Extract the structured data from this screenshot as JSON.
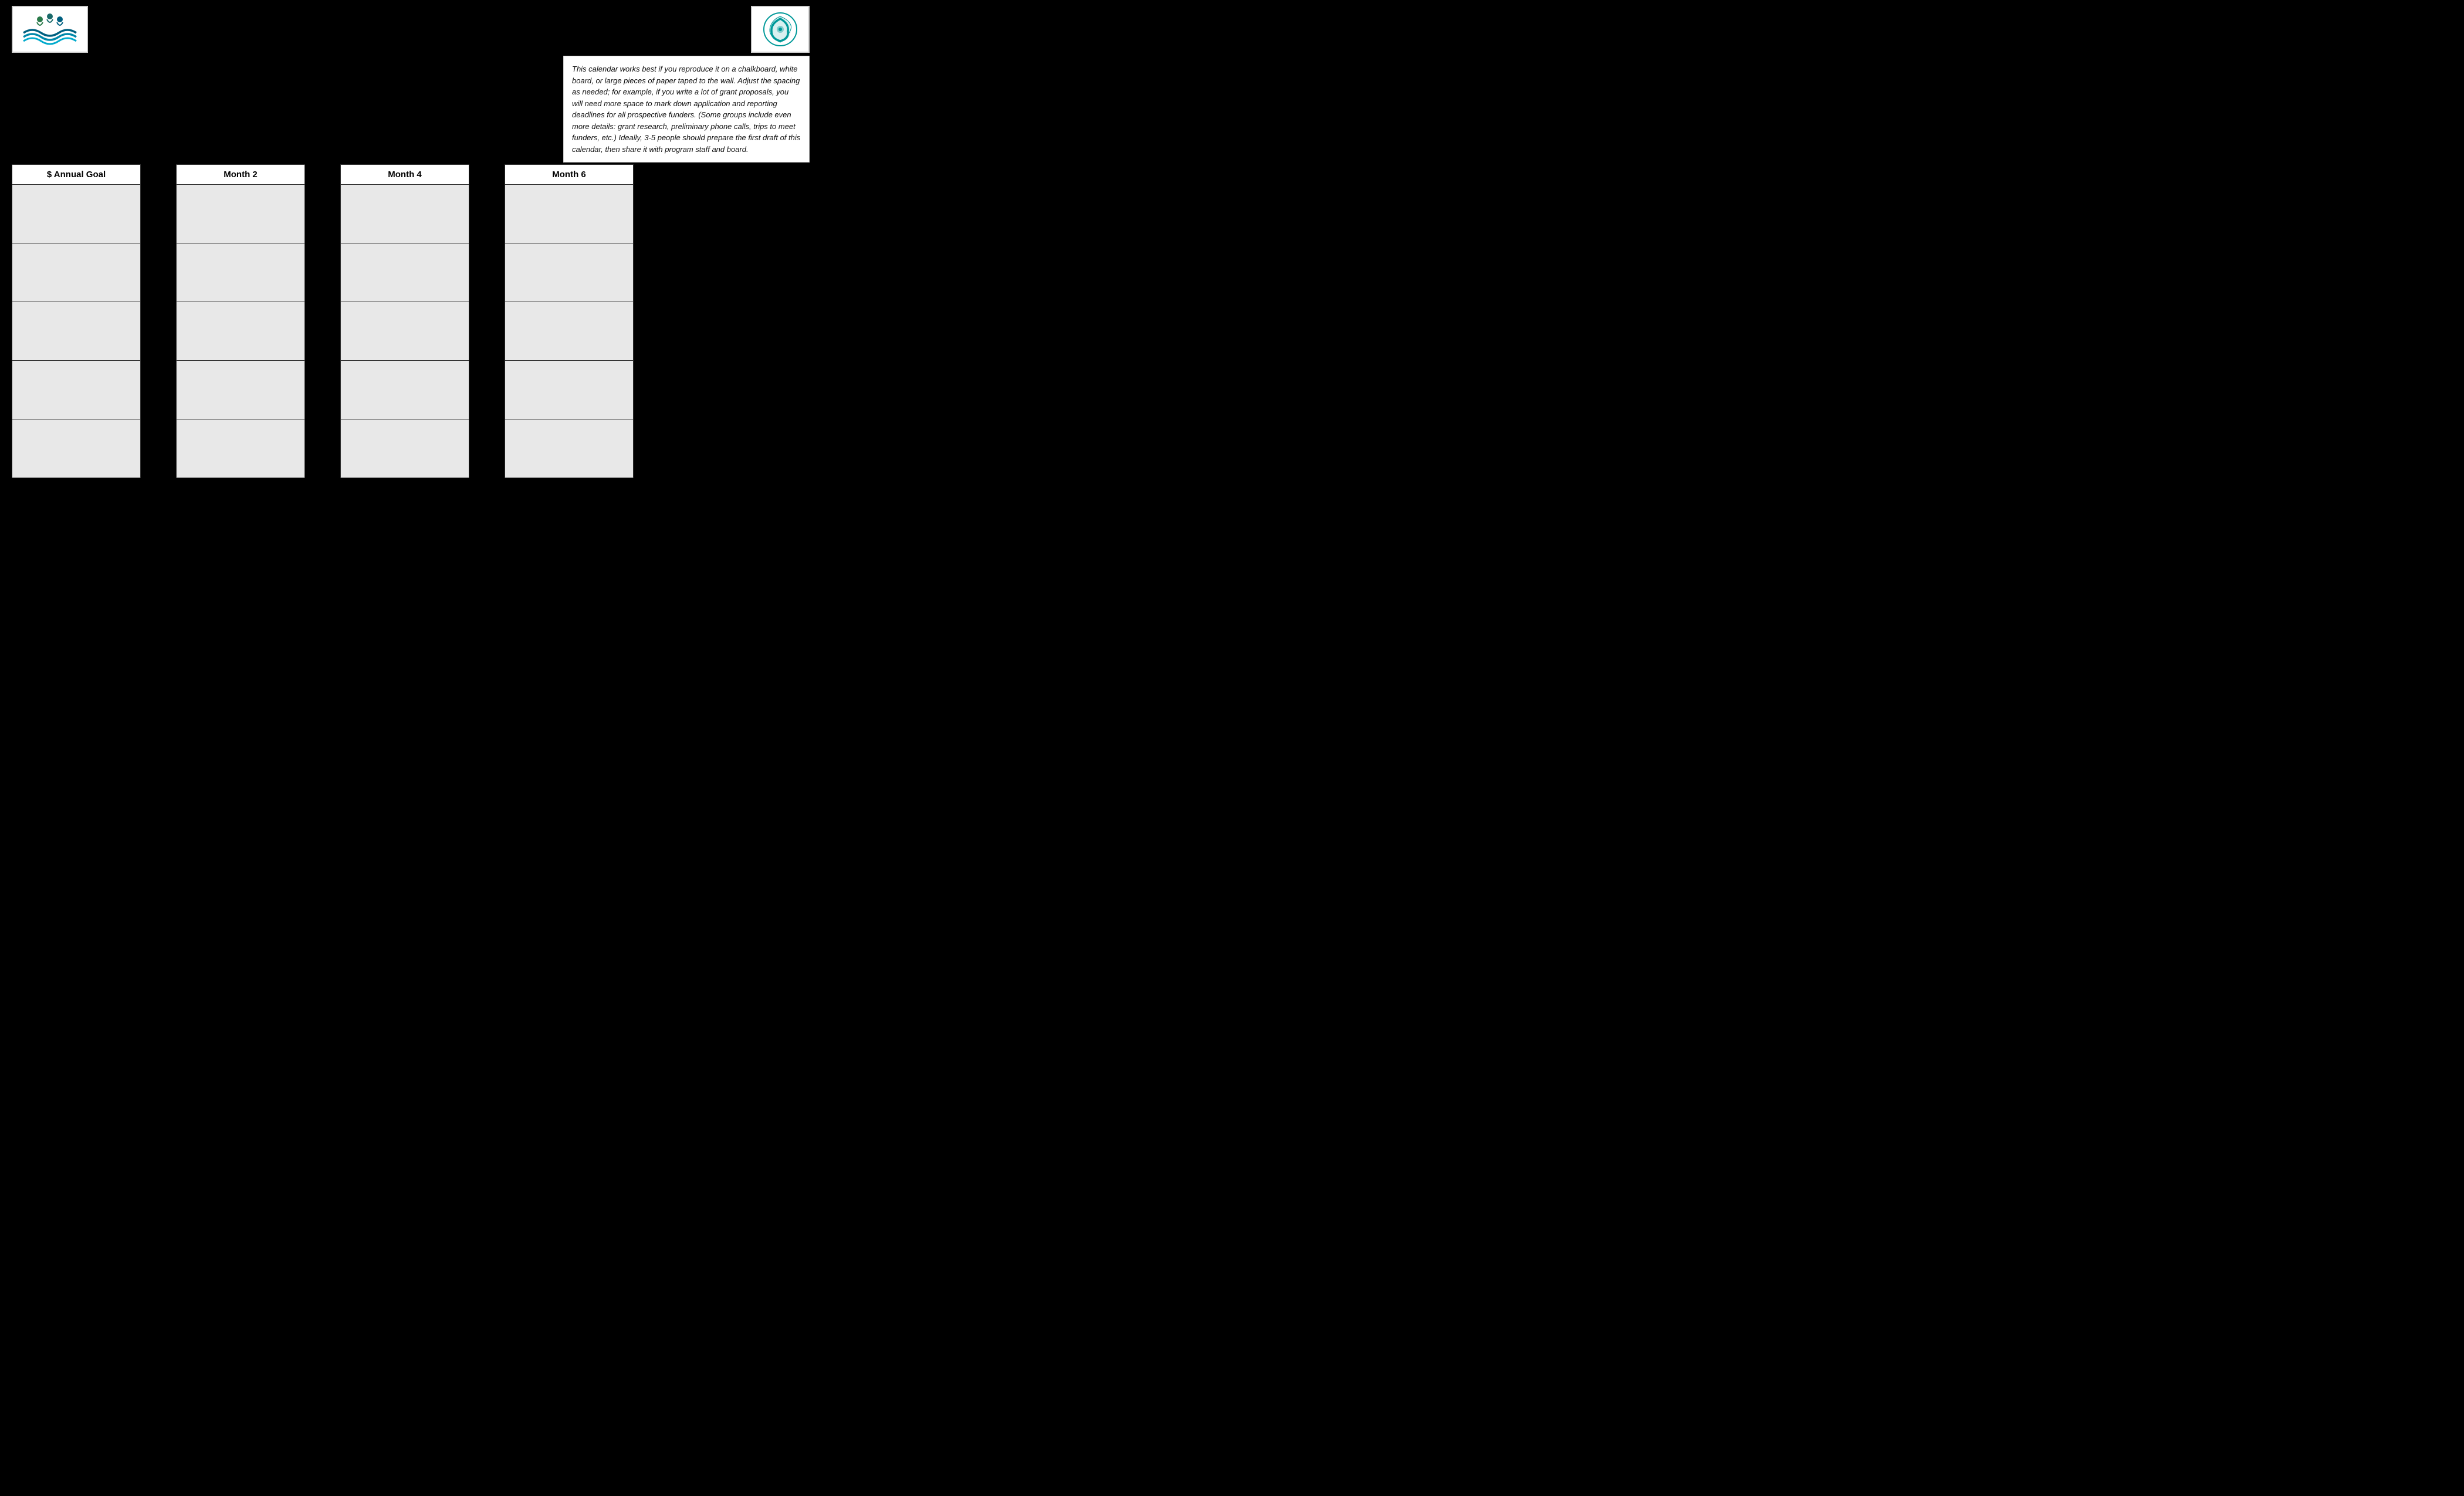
{
  "header": {
    "logo_left_alt": "Organization Logo Left",
    "logo_right_alt": "Organization Logo Right"
  },
  "info_box": {
    "text": "This calendar works best if you reproduce it on a chalkboard, white board, or large pieces of paper taped to the wall.  Adjust the spacing as needed; for example, if you write a lot of grant proposals, you will need more space to mark down application and reporting deadlines for all prospective funders. (Some groups include even more details: grant research, preliminary phone calls, trips to meet funders, etc.)  Ideally, 3-5 people should prepare the first draft of this calendar, then share it with program staff and board."
  },
  "columns": [
    {
      "id": "col1",
      "header": "$ Annual Goal",
      "cells": 5
    },
    {
      "id": "col2",
      "header": "Month 2",
      "cells": 5
    },
    {
      "id": "col3",
      "header": "Month 4",
      "cells": 5
    },
    {
      "id": "col4",
      "header": "Month 6",
      "cells": 5
    }
  ]
}
